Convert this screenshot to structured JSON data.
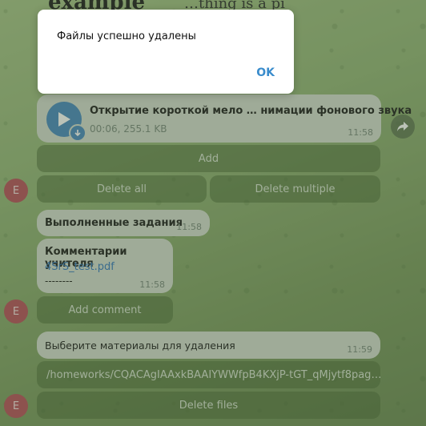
{
  "background_top": {
    "line1": "example",
    "line2": "…thing is a pi"
  },
  "audio_message": {
    "title": "Открытие короткой мело … нимации фонового звука",
    "meta": "00:06, 255.1 KB",
    "time": "11:58"
  },
  "buttons": {
    "add": "Add",
    "delete_all": "Delete all",
    "delete_multiple": "Delete multiple",
    "add_comment": "Add comment",
    "path": "/homeworks/CQACAgIAAxkBAAIYWWfpB4KXjP-tGT_qMjytf8pag…",
    "delete_files": "Delete files"
  },
  "msg_completed": {
    "text": "Выполненные задания",
    "time": "11:58"
  },
  "msg_teacher": {
    "title": "Комментарии учителя",
    "file": "4SrS_test.pdf",
    "sep": "--------",
    "time": "11:58"
  },
  "msg_select": {
    "text": "Выберите материалы для удаления",
    "time": "11:59"
  },
  "avatar_letter": "E",
  "dialog": {
    "message": "Файлы успешно удалены",
    "ok": "OK"
  },
  "colors": {
    "accent": "#3a8ccc",
    "avatar": "#b8545f",
    "bubble": "#d5dcd0"
  }
}
